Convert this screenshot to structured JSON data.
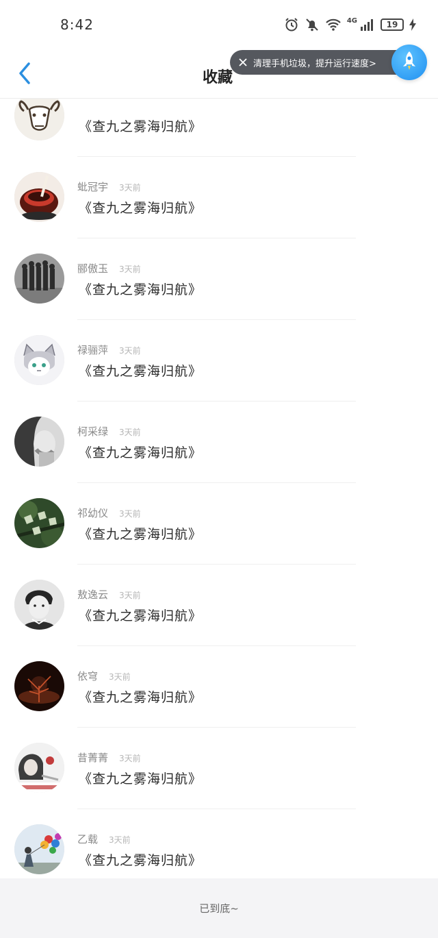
{
  "status_bar": {
    "time": "8:42",
    "network": "4G",
    "battery": "19",
    "icons": [
      "alarm-icon",
      "bell-muted-icon",
      "wifi-icon",
      "signal-icon",
      "battery-icon",
      "charging-icon"
    ]
  },
  "header": {
    "title": "收藏",
    "back_icon": "chevron-left-icon",
    "toast": {
      "text": "清理手机垃圾，提升运行速度>",
      "close_icon": "close-icon"
    },
    "rocket_icon": "rocket-icon"
  },
  "list": {
    "items": [
      {
        "name": "",
        "time": "",
        "title": "《查九之雾海归航》",
        "avatar": {
          "kind": "goat",
          "colors": [
            "#f2efe9",
            "#4a3b2e"
          ]
        }
      },
      {
        "name": "蚍冠宇",
        "time": "3天前",
        "title": "《查九之雾海归航》",
        "avatar": {
          "kind": "dessert",
          "colors": [
            "#5a1810",
            "#c83a2c"
          ]
        }
      },
      {
        "name": "郦傲玉",
        "time": "3天前",
        "title": "《查九之雾海归航》",
        "avatar": {
          "kind": "crowd",
          "colors": [
            "#9a9a9a",
            "#2c2c2c"
          ]
        }
      },
      {
        "name": "禄骊萍",
        "time": "3天前",
        "title": "《查九之雾海归航》",
        "avatar": {
          "kind": "anime",
          "colors": [
            "#f3f3f6",
            "#7a7a86"
          ]
        }
      },
      {
        "name": "柯采绿",
        "time": "3天前",
        "title": "《查九之雾海归航》",
        "avatar": {
          "kind": "portrait-bw",
          "colors": [
            "#d9d9d9",
            "#3a3a3a"
          ]
        }
      },
      {
        "name": "祁幼仪",
        "time": "3天前",
        "title": "《查九之雾海归航》",
        "avatar": {
          "kind": "leaves",
          "colors": [
            "#2f4a2a",
            "#9cb58a"
          ]
        }
      },
      {
        "name": "敖逸云",
        "time": "3天前",
        "title": "《查九之雾海归航》",
        "avatar": {
          "kind": "boy",
          "colors": [
            "#e5e5e5",
            "#252525"
          ]
        }
      },
      {
        "name": "依穹",
        "time": "3天前",
        "title": "《查九之雾海归航》",
        "avatar": {
          "kind": "night-tree",
          "colors": [
            "#1a0a06",
            "#c4512a"
          ]
        }
      },
      {
        "name": "昔菁菁",
        "time": "3天前",
        "title": "《查九之雾海归航》",
        "avatar": {
          "kind": "girl",
          "colors": [
            "#f1f1f1",
            "#c23c3c"
          ]
        }
      },
      {
        "name": "乙载",
        "time": "3天前",
        "title": "《查九之雾海归航》",
        "avatar": {
          "kind": "balloons",
          "colors": [
            "#dfe9f2",
            "#d93a3a"
          ]
        }
      }
    ]
  },
  "footer": {
    "text": "已到底~"
  }
}
